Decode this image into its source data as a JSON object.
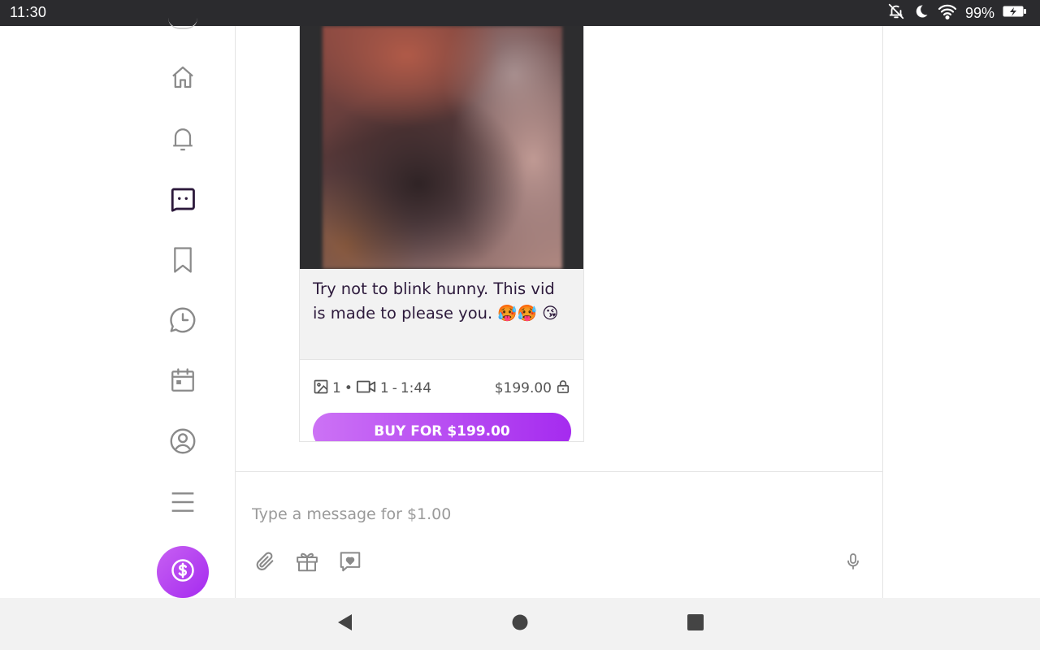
{
  "status_bar": {
    "time": "11:30",
    "battery": "99%",
    "icons": [
      "notifications-off-icon",
      "moon-icon",
      "wifi-icon",
      "battery-charging-icon"
    ]
  },
  "sidebar": {
    "items": [
      {
        "name": "home",
        "icon": "home-icon"
      },
      {
        "name": "notifications",
        "icon": "bell-icon"
      },
      {
        "name": "messages",
        "icon": "message-icon",
        "active": true
      },
      {
        "name": "bookmarks",
        "icon": "bookmark-icon"
      },
      {
        "name": "history",
        "icon": "chat-clock-icon"
      },
      {
        "name": "calendar",
        "icon": "calendar-icon"
      },
      {
        "name": "profile",
        "icon": "user-circle-icon"
      },
      {
        "name": "more",
        "icon": "menu-icon"
      }
    ],
    "tip_button_icon": "dollar-icon",
    "active_color": "#2d1a3c",
    "inactive_color": "#8a8a8a"
  },
  "message": {
    "text": "Try not to blink hunny. This vid is made to please you. 🥵🥵 😘",
    "media": {
      "photo_count": "1",
      "separator": "•",
      "video_count": "1",
      "dash": "-",
      "duration": "1:44"
    },
    "price": "$199.00",
    "buy_label": "BUY FOR $199.00"
  },
  "composer": {
    "placeholder": "Type a message for $1.00",
    "buttons": [
      "paperclip-icon",
      "gift-icon",
      "heart-message-icon",
      "microphone-icon"
    ]
  },
  "nav_bar": {
    "buttons": [
      "back-icon",
      "home-circle-icon",
      "recents-icon"
    ]
  },
  "colors": {
    "accent": "#a52bef",
    "accent_light": "#cc72f5",
    "status_bar": "#2b2b2e",
    "nav_bar": "#f2f2f2"
  }
}
